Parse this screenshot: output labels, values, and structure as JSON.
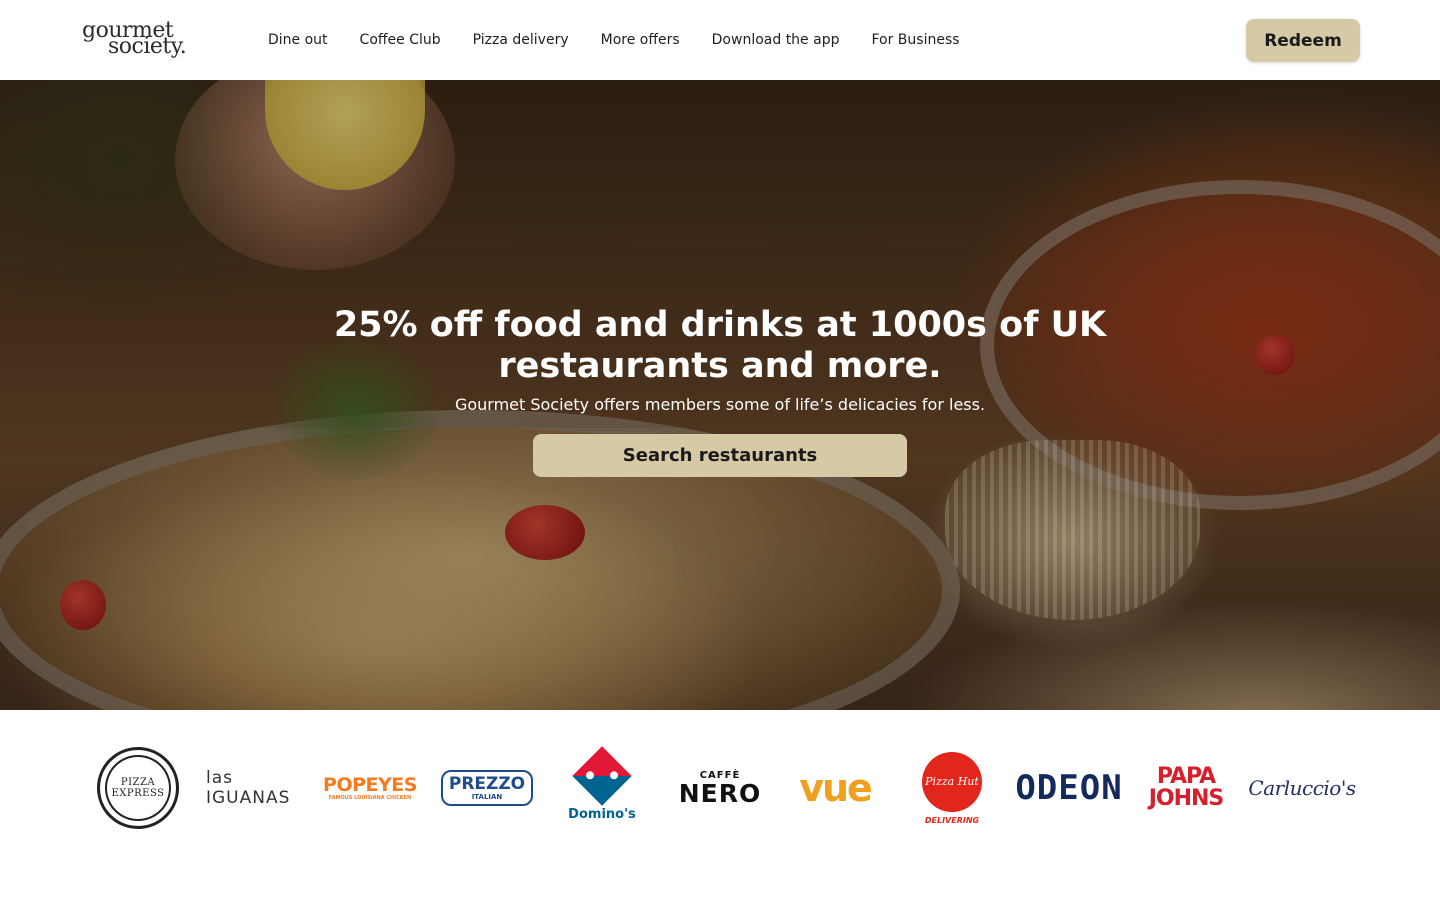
{
  "header": {
    "logo_line1": "gourmet",
    "logo_line2": "society.",
    "nav": [
      "Dine out",
      "Coffee Club",
      "Pizza delivery",
      "More offers",
      "Download the app",
      "For Business"
    ],
    "redeem_label": "Redeem"
  },
  "hero": {
    "title": "25% off food and drinks at 1000s of UK restaurants and more.",
    "subtitle": "Gourmet Society offers members some of life’s delicacies for less.",
    "cta_label": "Search restaurants"
  },
  "brands": {
    "pizza_express": [
      "PIZZA",
      "EXPRESS"
    ],
    "las_iguanas": "las IGUANAS",
    "popeyes": "POPEYES",
    "popeyes_tagline": "FAMOUS LOUISIANA CHICKEN",
    "prezzo": "PREZZO",
    "prezzo_tagline": "ITALIAN",
    "dominos": "Domino's",
    "caffe_nero_top": "CAFFÈ",
    "caffe_nero_main": "NERO",
    "vue": "vue",
    "pizza_hut": "Pizza Hut",
    "pizza_hut_tagline": "DELIVERING",
    "odeon": "ODEON",
    "papa_johns": [
      "PAPA",
      "JOHNS"
    ],
    "carluccios": "Carluccio's"
  },
  "colors": {
    "accent_button": "#d6c9a6",
    "text_dark": "#1a1a1a"
  }
}
